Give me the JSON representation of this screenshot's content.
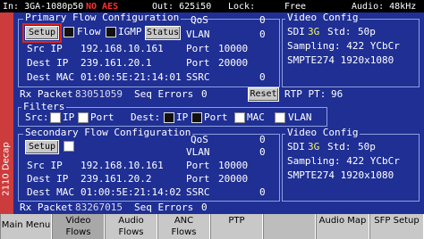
{
  "status": {
    "input": "In: 3GA-1080p50",
    "no_aes": "NO AES",
    "output": "Out: 625i50",
    "lock": "Lock:",
    "lock_value": "Free",
    "audio": "Audio: 48kHz"
  },
  "sidebar_label": "2110 Decap",
  "primary": {
    "title": "Primary Flow Configuration",
    "setup": "Setup",
    "flow": "Flow",
    "igmp": "IGMP",
    "status": "Status",
    "src_ip_label": "Src IP",
    "src_ip": "192.168.10.161",
    "dest_ip_label": "Dest IP",
    "dest_ip": "239.161.20.1",
    "dest_mac_label": "Dest MAC",
    "dest_mac": "01:00:5E:21:14:01",
    "qos_label": "QoS",
    "qos": "0",
    "vlan_label": "VLAN",
    "vlan": "0",
    "port_label": "Port",
    "src_port": "10000",
    "dest_port": "20000",
    "ssrc_label": "SSRC",
    "ssrc": "0",
    "rx_label": "Rx Packet",
    "rx_value": "83051059",
    "seq_label": "Seq Errors",
    "seq_value": "0"
  },
  "video1": {
    "title": "Video Config",
    "sdi": "SDI",
    "g3": "3G",
    "std_label": "Std:",
    "std": "50p",
    "sampling": "Sampling: 422 YCbCr",
    "smpte": "SMPTE274 1920x1080"
  },
  "reset": "Reset",
  "rtp_pt_label": "RTP PT:",
  "rtp_pt": "96",
  "filters": {
    "title": "Filters",
    "src_label": "Src:",
    "ip": "IP",
    "port": "Port",
    "dest_label": "Dest:",
    "mac": "MAC",
    "vlan": "VLAN"
  },
  "secondary": {
    "title": "Secondary Flow Configuration",
    "setup": "Setup",
    "src_ip_label": "Src IP",
    "src_ip": "192.168.10.161",
    "dest_ip_label": "Dest IP",
    "dest_ip": "239.161.20.2",
    "dest_mac_label": "Dest MAC",
    "dest_mac": "01:00:5E:21:14:02",
    "qos_label": "QoS",
    "qos": "0",
    "vlan_label": "VLAN",
    "vlan": "0",
    "port_label": "Port",
    "src_port": "10000",
    "dest_port": "20000",
    "ssrc_label": "SSRC",
    "ssrc": "0",
    "rx_label": "Rx Packet",
    "rx_value": "83267015",
    "seq_label": "Seq Errors",
    "seq_value": "0"
  },
  "video2": {
    "title": "Video Config",
    "sdi": "SDI",
    "g3": "3G",
    "std_label": "Std:",
    "std": "50p",
    "sampling": "Sampling: 422 YCbCr",
    "smpte": "SMPTE274 1920x1080"
  },
  "tabs": {
    "main_menu": "Main Menu",
    "video_flows_1": "Video",
    "video_flows_2": "Flows",
    "audio_flows_1": "Audio",
    "audio_flows_2": "Flows",
    "anc_flows_1": "ANC",
    "anc_flows_2": "Flows",
    "ptp": "PTP",
    "audio_map": "Audio Map",
    "sfp_setup": "SFP Setup"
  }
}
